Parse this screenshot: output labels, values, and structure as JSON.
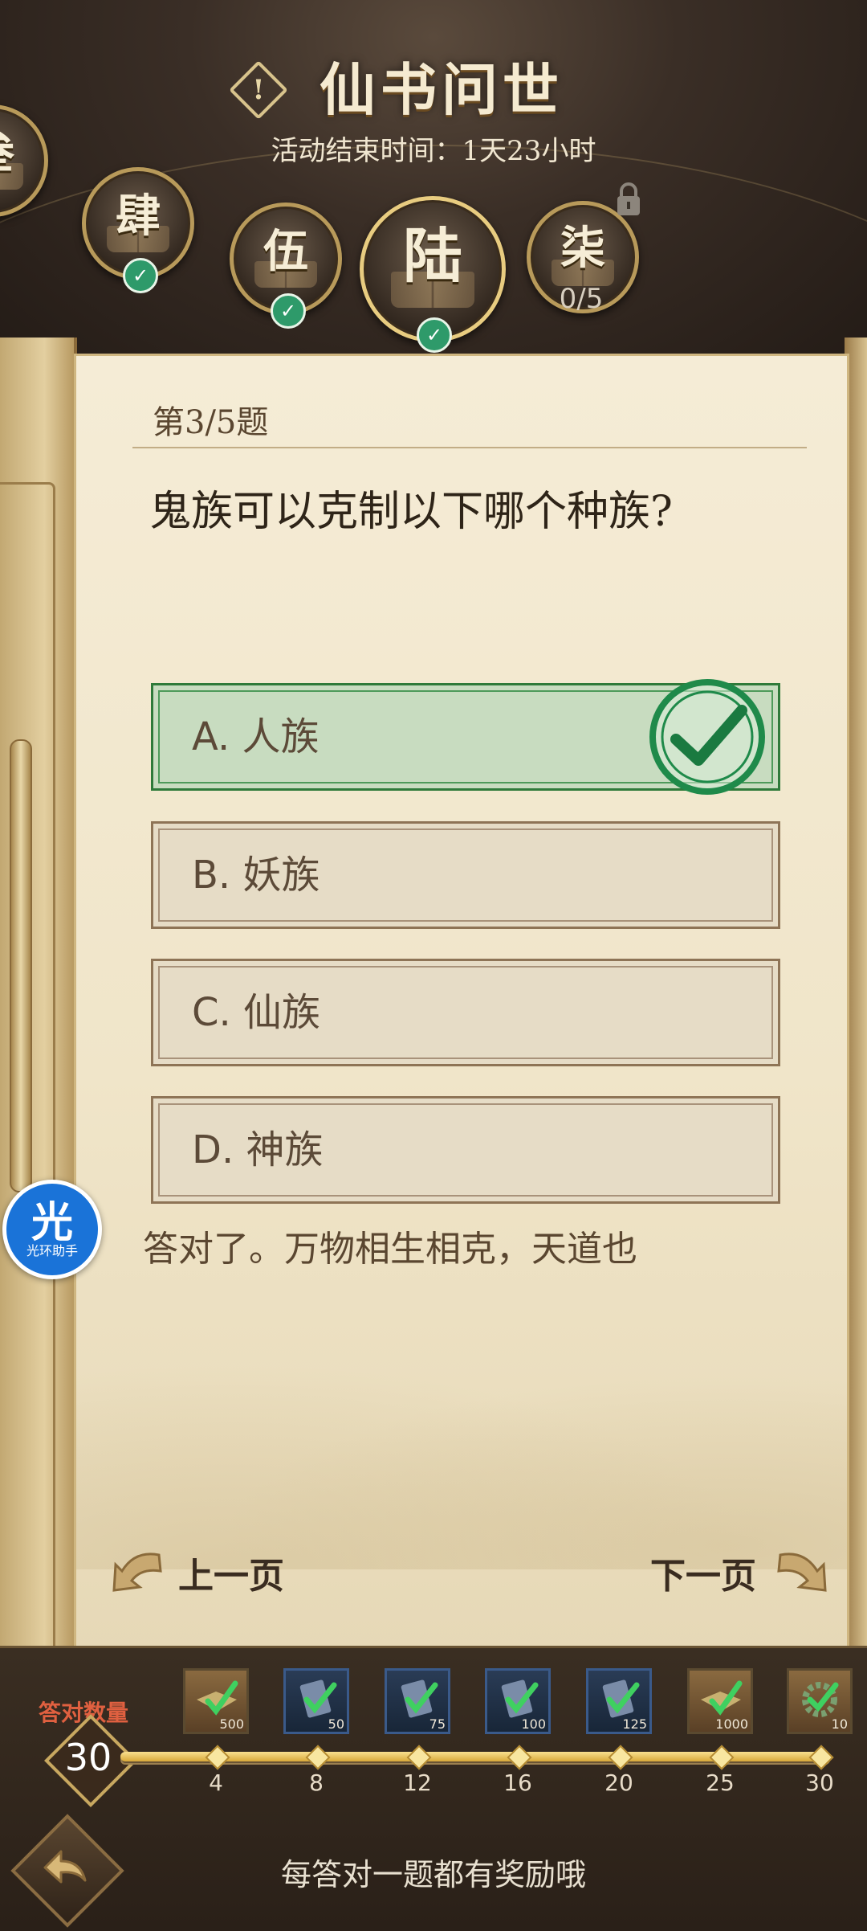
{
  "header": {
    "title": "仙书问世",
    "subtitle": "活动结束时间：1天23小时",
    "alert_icon": "exclamation-icon",
    "chapters": [
      {
        "label": "叁",
        "state": "completed"
      },
      {
        "label": "肆",
        "state": "completed"
      },
      {
        "label": "伍",
        "state": "completed"
      },
      {
        "label": "陆",
        "state": "completed-selected"
      },
      {
        "label": "柒",
        "state": "locked",
        "progress": "0/5"
      }
    ]
  },
  "quiz": {
    "question_number": "第3/5题",
    "question": "鬼族可以克制以下哪个种族?",
    "options": [
      {
        "label": "A. 人族",
        "correct": true
      },
      {
        "label": "B. 妖族",
        "correct": false
      },
      {
        "label": "C. 仙族",
        "correct": false
      },
      {
        "label": "D. 神族",
        "correct": false
      }
    ],
    "feedback": "答对了。万物相生相克，天道也",
    "prev_label": "上一页",
    "next_label": "下一页"
  },
  "helper": {
    "glyph": "光",
    "name": "光环助手"
  },
  "rewards": {
    "count_label": "答对数量",
    "count_value": "30",
    "items": [
      {
        "qty": "500",
        "milestone": "4",
        "icon": "green-scroll-icon"
      },
      {
        "qty": "50",
        "milestone": "8",
        "icon": "blue-book-icon"
      },
      {
        "qty": "75",
        "milestone": "12",
        "icon": "blue-book-icon"
      },
      {
        "qty": "100",
        "milestone": "16",
        "icon": "blue-book-icon"
      },
      {
        "qty": "125",
        "milestone": "20",
        "icon": "blue-book-icon"
      },
      {
        "qty": "1000",
        "milestone": "25",
        "icon": "green-scroll-icon"
      },
      {
        "qty": "10",
        "milestone": "30",
        "icon": "gear-token-icon"
      }
    ],
    "tip": "每答对一题都有奖励哦"
  },
  "colors": {
    "correct_green": "#2f7a3a",
    "parchment": "#f0e5c9",
    "gold": "#c8a860",
    "helper_blue": "#1a73d8"
  }
}
